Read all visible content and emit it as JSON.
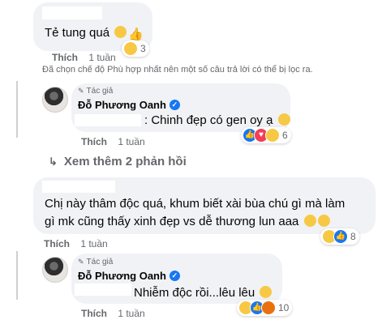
{
  "comment1": {
    "text": "Tẻ tung quá",
    "emoji_icons": [
      "rolling-laugh-icon",
      "thumbs-up-icon"
    ],
    "reaction_icons": [
      "haha-icon"
    ],
    "reaction_count": "3",
    "like_label": "Thích",
    "time": "1 tuần"
  },
  "filter_notice": "Đã chọn chế độ Phù hợp nhất nên một số câu trả lời có thể bị lọc ra.",
  "reply1": {
    "author_tag": "Tác giả",
    "author": "Đỗ Phương Oanh",
    "text": ": Chinh đẹp có gen oy ạ",
    "emoji_icons": [
      "grin-icon"
    ],
    "reaction_icons": [
      "like-icon",
      "love-icon",
      "haha-icon"
    ],
    "reaction_count": "6",
    "like_label": "Thích",
    "time": "1 tuần"
  },
  "more_replies": {
    "label": "Xem thêm 2 phản hồi"
  },
  "comment2": {
    "text_line1": "Chị này thâm độc quá, khum biết xài bùa chú gì mà làm",
    "text_line2": "gì mk cũng thấy xinh đẹp vs dễ thương lun aaa",
    "emoji_icons": [
      "pleading-icon",
      "worried-icon"
    ],
    "reaction_icons": [
      "haha-icon",
      "like-icon"
    ],
    "reaction_count": "8",
    "like_label": "Thích",
    "time": "1 tuần"
  },
  "reply2": {
    "author_tag": "Tác giả",
    "author": "Đỗ Phương Oanh",
    "text": "Nhiễm độc rồi...lêu lêu",
    "emoji_icons": [
      "grin-icon"
    ],
    "reaction_icons": [
      "haha-icon",
      "like-icon",
      "angry-icon"
    ],
    "reaction_count": "10",
    "like_label": "Thích",
    "time": "1 tuần"
  },
  "colors": {
    "bubble": "#f0f2f5",
    "secondary_text": "#65676b",
    "verified": "#1877f2"
  }
}
